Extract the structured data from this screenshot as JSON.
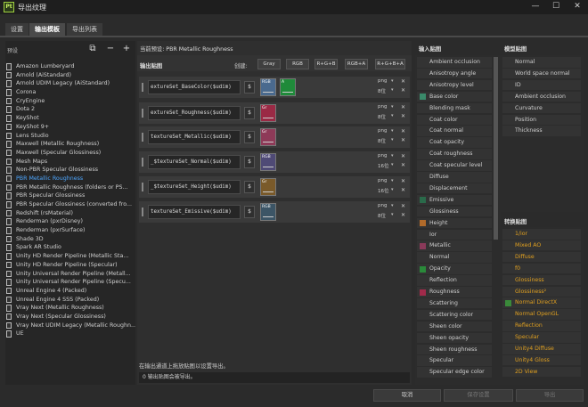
{
  "window": {
    "title": "导出纹理",
    "app_icon": "Pt",
    "min": "—",
    "max": "☐",
    "close": "✕"
  },
  "tabs": [
    {
      "label": "设置"
    },
    {
      "label": "输出模板"
    },
    {
      "label": "导出列表"
    }
  ],
  "presets": {
    "label": "预设",
    "items": [
      "Amazon Lumberyard",
      "Arnold (AiStandard)",
      "Arnold UDIM Legacy (AiStandard)",
      "Corona",
      "CryEngine",
      "Dota 2",
      "KeyShot",
      "KeyShot 9+",
      "Lens Studio",
      "Maxwell (Metallic Roughness)",
      "Maxwell (Specular Glossiness)",
      "Mesh Maps",
      "Non-PBR Specular Glossiness",
      "PBR Metallic Roughness",
      "PBR Metallic Roughness (folders or PS...",
      "PBR Specular Glossiness",
      "PBR Specular Glossiness (converted fro...",
      "Redshift (rsMaterial)",
      "Renderman (pxrDisney)",
      "Renderman (pxrSurface)",
      "Shade 3D",
      "Spark AR Studio",
      "Unity HD Render Pipeline (Metallic Sta...",
      "Unity HD Render Pipeline (Specular)",
      "Unity Universal Render Pipeline (Metall...",
      "Unity Universal Render Pipeline (Specu...",
      "Unreal Engine 4 (Packed)",
      "Unreal Engine 4 SSS (Packed)",
      "Vray Next (Metallic Roughness)",
      "Vray Next (Specular Glossiness)",
      "Vray Next UDIM Legacy (Metallic Roughn...",
      "UE"
    ],
    "selected_index": 13
  },
  "middle": {
    "current_preset": "当前预设: PBR Metallic Roughness",
    "output_maps_label": "输出贴图",
    "create_label": "创建:",
    "create_buttons": [
      "Gray",
      "RGB",
      "R+G+B",
      "RGB+A",
      "R+G+B+A"
    ],
    "rows": [
      {
        "name": "extureSet_BaseColor($udim)",
        "dollar": "$",
        "channels": [
          {
            "label": "RGB",
            "color": "#4a6a8e"
          },
          {
            "label": "A",
            "color": "#1f8a3a"
          }
        ],
        "format": "png",
        "bits": "8位",
        "dd": "▾",
        "x": "✕"
      },
      {
        "name": "extureSet_Roughness($udim)",
        "dollar": "$",
        "channels": [
          {
            "label": "Gr",
            "color": "#9a2a45"
          }
        ],
        "format": "png",
        "bits": "8位",
        "dd": "▾",
        "x": "✕"
      },
      {
        "name": "textureSet_Metallic($udim)",
        "dollar": "$",
        "channels": [
          {
            "label": "Gr",
            "color": "#8e3a58"
          }
        ],
        "format": "png",
        "bits": "8位",
        "dd": "▾",
        "x": "✕"
      },
      {
        "name": "_$textureSet_Normal($udim)",
        "dollar": "$",
        "channels": [
          {
            "label": "RGB",
            "color": "#4f4a76"
          }
        ],
        "format": "png",
        "bits": "16位",
        "dd": "▾",
        "x": "✕"
      },
      {
        "name": "_$textureSet_Height($udim)",
        "dollar": "$",
        "channels": [
          {
            "label": "Gr",
            "color": "#7a5a2a"
          }
        ],
        "format": "png",
        "bits": "16位",
        "dd": "▾",
        "x": "✕"
      },
      {
        "name": "textureSet_Emissive($udim)",
        "dollar": "$",
        "channels": [
          {
            "label": "RGB",
            "color": "#3c5566"
          }
        ],
        "format": "png",
        "bits": "8位",
        "dd": "▾",
        "x": "✕"
      }
    ],
    "note": "在输出通道上拖放贴图以设置导出。",
    "warning": "0 输出贴图会被导出。"
  },
  "input_maps": {
    "header": "输入贴图",
    "items": [
      {
        "label": "Ambient occlusion",
        "color": ""
      },
      {
        "label": "Anisotropy angle",
        "color": ""
      },
      {
        "label": "Anisotropy level",
        "color": ""
      },
      {
        "label": "Base color",
        "color": "#3a8a6a"
      },
      {
        "label": "Blending mask",
        "color": ""
      },
      {
        "label": "Coat color",
        "color": ""
      },
      {
        "label": "Coat normal",
        "color": ""
      },
      {
        "label": "Coat opacity",
        "color": ""
      },
      {
        "label": "Coat roughness",
        "color": ""
      },
      {
        "label": "Coat specular level",
        "color": ""
      },
      {
        "label": "Diffuse",
        "color": ""
      },
      {
        "label": "Displacement",
        "color": ""
      },
      {
        "label": "Emissive",
        "color": "#2a6a4a"
      },
      {
        "label": "Glossiness",
        "color": ""
      },
      {
        "label": "Height",
        "color": "#b06a2a"
      },
      {
        "label": "Ior",
        "color": ""
      },
      {
        "label": "Metallic",
        "color": "#8a3a5a"
      },
      {
        "label": "Normal",
        "color": ""
      },
      {
        "label": "Opacity",
        "color": "#2a8a3a"
      },
      {
        "label": "Reflection",
        "color": ""
      },
      {
        "label": "Roughness",
        "color": "#a02a4a"
      },
      {
        "label": "Scattering",
        "color": ""
      },
      {
        "label": "Scattering color",
        "color": ""
      },
      {
        "label": "Sheen color",
        "color": ""
      },
      {
        "label": "Sheen opacity",
        "color": ""
      },
      {
        "label": "Sheen roughness",
        "color": ""
      },
      {
        "label": "Specular",
        "color": ""
      },
      {
        "label": "Specular edge color",
        "color": ""
      }
    ]
  },
  "mesh_maps": {
    "header": "模型贴图",
    "items": [
      "Normal",
      "World space normal",
      "ID",
      "Ambient occlusion",
      "Curvature",
      "Position",
      "Thickness"
    ]
  },
  "converted_maps": {
    "header": "转换贴图",
    "items": [
      "1/ior",
      "Mixed AO",
      "Diffuse",
      "f0",
      "Glossiness",
      "Glossiness²",
      "Normal DirectX",
      "Normal OpenGL",
      "Reflection",
      "Specular",
      "Unity4 Diffuse",
      "Unity4 Gloss",
      "2D View"
    ]
  },
  "bottom": {
    "cancel": "取消",
    "save": "保存设置",
    "export": "导出"
  },
  "colors": {
    "accent": "#4da6ff",
    "converted": "#e0a020"
  }
}
